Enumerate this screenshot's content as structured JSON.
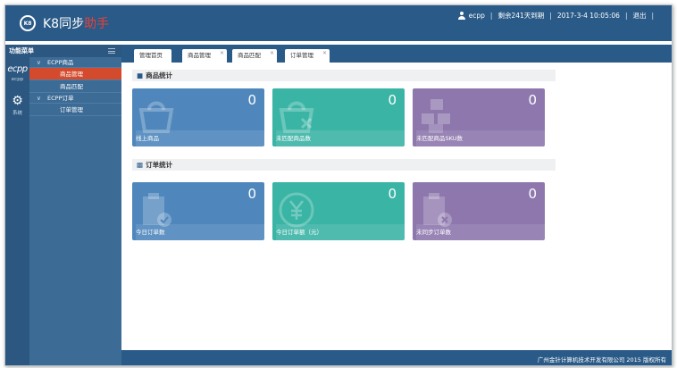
{
  "header": {
    "logo_icon_text": "K8",
    "app_name": "K8同步",
    "app_name_accent": "助手",
    "user": "ecpp",
    "remaining": "剩余241天到期",
    "datetime": "2017-3-4 10:05:06",
    "logout": "退出"
  },
  "sidebar": {
    "title": "功能菜单",
    "rail": [
      {
        "icon": "ecpp-logo-icon",
        "label": "ecpp",
        "sub": "ecpp"
      },
      {
        "icon": "gear-icon",
        "label": "系统"
      }
    ],
    "groups": [
      {
        "label": "ECPP商品",
        "items": [
          {
            "label": "商品管理",
            "active": true
          },
          {
            "label": "商品匹配",
            "active": false
          }
        ]
      },
      {
        "label": "ECPP订单",
        "items": [
          {
            "label": "订单管理",
            "active": false
          }
        ]
      }
    ]
  },
  "tabs": [
    {
      "label": "管理首页",
      "closable": false
    },
    {
      "label": "商品管理",
      "closable": true
    },
    {
      "label": "商品匹配",
      "closable": true
    },
    {
      "label": "订单管理",
      "closable": true
    }
  ],
  "sections": {
    "product": {
      "title": "商品统计",
      "cards": [
        {
          "label": "线上商品",
          "value": "0",
          "color": "#4f87bd",
          "icon": "shopping-bag-icon"
        },
        {
          "label": "未匹配商品数",
          "value": "0",
          "color": "#3ab4a5",
          "icon": "bag-x-icon"
        },
        {
          "label": "未匹配商品SKU数",
          "value": "0",
          "color": "#8d77ad",
          "icon": "boxes-icon"
        }
      ]
    },
    "order": {
      "title": "订单统计",
      "cards": [
        {
          "label": "今日订单数",
          "value": "0",
          "color": "#4f87bd",
          "icon": "clipboard-check-icon"
        },
        {
          "label": "今日订单额（元）",
          "value": "0",
          "color": "#3ab4a5",
          "icon": "yuan-coin-icon"
        },
        {
          "label": "未同步订单数",
          "value": "0",
          "color": "#8d77ad",
          "icon": "clipboard-x-icon"
        }
      ]
    }
  },
  "footer": {
    "text": "广州金针计算机技术开发有限公司 2015 版权所有"
  }
}
